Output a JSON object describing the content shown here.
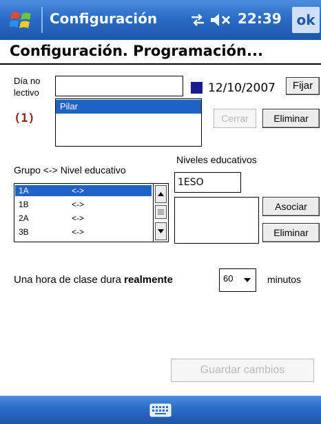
{
  "titlebar": {
    "title": "Configuración",
    "time": "22:39",
    "ok_label": "ok",
    "icons": [
      "windows-logo-icon",
      "connectivity-icon",
      "volume-muted-icon"
    ]
  },
  "page": {
    "heading": "Configuración. Programación..."
  },
  "holidays": {
    "label_line1": "Día no",
    "label_line2": "lectivo",
    "input_value": "",
    "date": "12/10/2007",
    "date_swatch_color": "#1b1b8f",
    "fijar_label": "Fijar",
    "count_label": "(1)",
    "list_items": [
      "Pilar"
    ],
    "cerrar_label": "Cerrar",
    "eliminar_label": "Eliminar"
  },
  "groups": {
    "label": "Grupo <-> Nivel educativo",
    "rows": [
      {
        "group": "1A",
        "link": "<->"
      },
      {
        "group": "1B",
        "link": "<->"
      },
      {
        "group": "2A",
        "link": "<->"
      },
      {
        "group": "3B",
        "link": "<->"
      }
    ]
  },
  "levels": {
    "label": "Niveles educativos",
    "input_value": "1ESO",
    "asociar_label": "Asociar",
    "eliminar_label": "Eliminar"
  },
  "class_duration": {
    "text_before": "Una hora de clase dura ",
    "text_bold": "realmente",
    "minutes_value": "60",
    "minutes_label": "minutos"
  },
  "actions": {
    "save_label": "Guardar cambios"
  },
  "colors": {
    "taskbar": "#2b6cc6",
    "selection": "#1f63c6"
  }
}
